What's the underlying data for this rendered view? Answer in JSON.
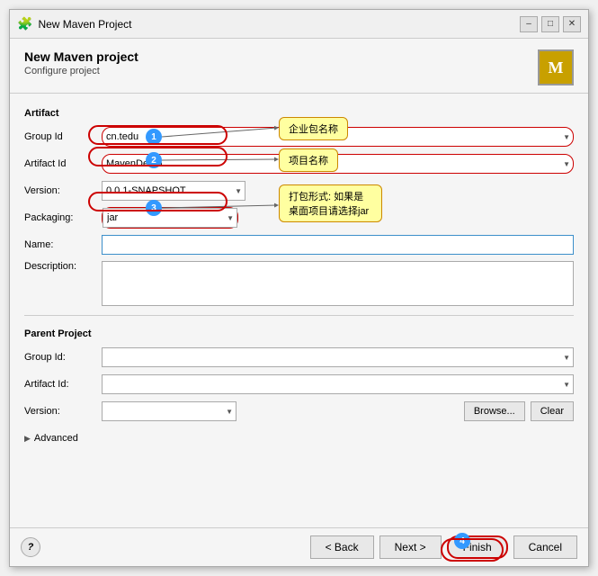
{
  "window": {
    "title": "New Maven Project",
    "icon": "🧩"
  },
  "header": {
    "title": "New Maven project",
    "subtitle": "Configure project",
    "maven_icon_letter": "M"
  },
  "artifact_section": {
    "label": "Artifact"
  },
  "form": {
    "group_id_label": "Group Id",
    "group_id_value": "cn.tedu",
    "artifact_id_label": "Artifact Id",
    "artifact_id_value": "MavenDemo",
    "version_label": "Version:",
    "version_value": "0.0.1-SNAPSHOT",
    "packaging_label": "Packaging:",
    "packaging_value": "jar",
    "name_label": "Name:",
    "name_value": "",
    "description_label": "Description:",
    "description_value": ""
  },
  "parent_project": {
    "label": "Parent Project",
    "group_id_label": "Group Id:",
    "group_id_value": "",
    "artifact_id_label": "Artifact Id:",
    "artifact_id_value": "",
    "version_label": "Version:",
    "version_value": "",
    "browse_label": "Browse...",
    "clear_label": "Clear"
  },
  "advanced": {
    "label": "Advanced"
  },
  "footer": {
    "help_label": "?",
    "back_label": "< Back",
    "next_label": "Next >",
    "finish_label": "Finish",
    "cancel_label": "Cancel"
  },
  "annotations": {
    "bubble1": "企业包名称",
    "bubble2": "项目名称",
    "bubble3_line1": "打包形式: 如",
    "bubble3_line2": "果是桌面项目",
    "bubble3_line3": "请选择jar",
    "badge1": "1",
    "badge2": "2",
    "badge3": "3",
    "badge4": "4"
  },
  "title_controls": {
    "minimize": "–",
    "maximize": "□",
    "close": "✕"
  }
}
